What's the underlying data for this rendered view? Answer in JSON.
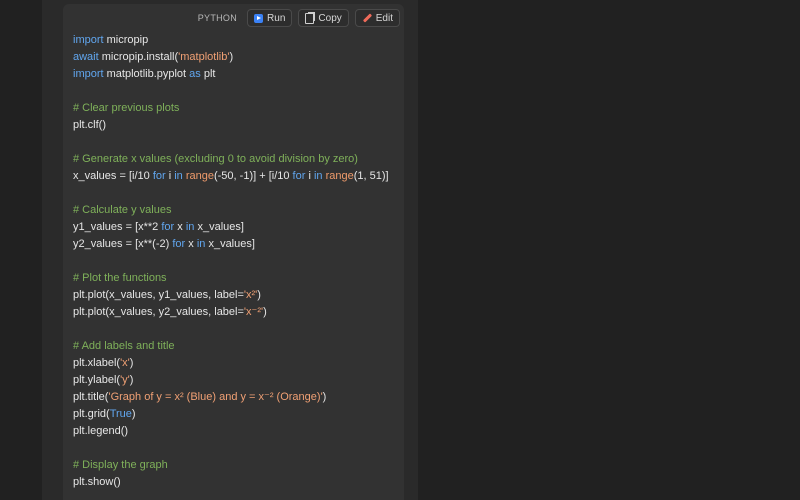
{
  "toolbar": {
    "language": "PYTHON",
    "run_label": "Run",
    "copy_label": "Copy",
    "edit_label": "Edit",
    "icons": {
      "run": "play-icon",
      "copy": "clipboard-icon",
      "edit": "pencil-icon"
    }
  },
  "code": {
    "lines": [
      [
        {
          "t": "import",
          "c": "kw"
        },
        {
          "t": " micropip"
        }
      ],
      [
        {
          "t": "await",
          "c": "kw"
        },
        {
          "t": " micropip.install("
        },
        {
          "t": "'matplotlib'",
          "c": "str"
        },
        {
          "t": ")"
        }
      ],
      [
        {
          "t": "import",
          "c": "kw"
        },
        {
          "t": " matplotlib.pyplot "
        },
        {
          "t": "as",
          "c": "kw"
        },
        {
          "t": " plt"
        }
      ],
      [],
      [
        {
          "t": "# Clear previous plots",
          "c": "cm"
        }
      ],
      [
        {
          "t": "plt.clf()"
        }
      ],
      [],
      [
        {
          "t": "# Generate x values (excluding 0 to avoid division by zero)",
          "c": "cm"
        }
      ],
      [
        {
          "t": "x_values = [i/10 "
        },
        {
          "t": "for",
          "c": "kw"
        },
        {
          "t": " i "
        },
        {
          "t": "in",
          "c": "kw"
        },
        {
          "t": " "
        },
        {
          "t": "range",
          "c": "fn"
        },
        {
          "t": "(-50, -1)] + [i/10 "
        },
        {
          "t": "for",
          "c": "kw"
        },
        {
          "t": " i "
        },
        {
          "t": "in",
          "c": "kw"
        },
        {
          "t": " "
        },
        {
          "t": "range",
          "c": "fn"
        },
        {
          "t": "(1, 51)]"
        }
      ],
      [],
      [
        {
          "t": "# Calculate y values",
          "c": "cm"
        }
      ],
      [
        {
          "t": "y1_values = [x**2 "
        },
        {
          "t": "for",
          "c": "kw"
        },
        {
          "t": " x "
        },
        {
          "t": "in",
          "c": "kw"
        },
        {
          "t": " x_values]"
        }
      ],
      [
        {
          "t": "y2_values = [x**(-2) "
        },
        {
          "t": "for",
          "c": "kw"
        },
        {
          "t": " x "
        },
        {
          "t": "in",
          "c": "kw"
        },
        {
          "t": " x_values]"
        }
      ],
      [],
      [
        {
          "t": "# Plot the functions",
          "c": "cm"
        }
      ],
      [
        {
          "t": "plt.plot(x_values, y1_values, label="
        },
        {
          "t": "'x²'",
          "c": "str"
        },
        {
          "t": ")"
        }
      ],
      [
        {
          "t": "plt.plot(x_values, y2_values, label="
        },
        {
          "t": "'x⁻²'",
          "c": "str"
        },
        {
          "t": ")"
        }
      ],
      [],
      [
        {
          "t": "# Add labels and title",
          "c": "cm"
        }
      ],
      [
        {
          "t": "plt.xlabel("
        },
        {
          "t": "'x'",
          "c": "str"
        },
        {
          "t": ")"
        }
      ],
      [
        {
          "t": "plt.ylabel("
        },
        {
          "t": "'y'",
          "c": "str"
        },
        {
          "t": ")"
        }
      ],
      [
        {
          "t": "plt.title("
        },
        {
          "t": "'Graph of y = x² (Blue) and y = x⁻² (Orange)'",
          "c": "str"
        },
        {
          "t": ")"
        }
      ],
      [
        {
          "t": "plt.grid("
        },
        {
          "t": "True",
          "c": "tr"
        },
        {
          "t": ")"
        }
      ],
      [
        {
          "t": "plt.legend()"
        }
      ],
      [],
      [
        {
          "t": "# Display the graph",
          "c": "cm"
        }
      ],
      [
        {
          "t": "plt.show()"
        }
      ]
    ]
  }
}
